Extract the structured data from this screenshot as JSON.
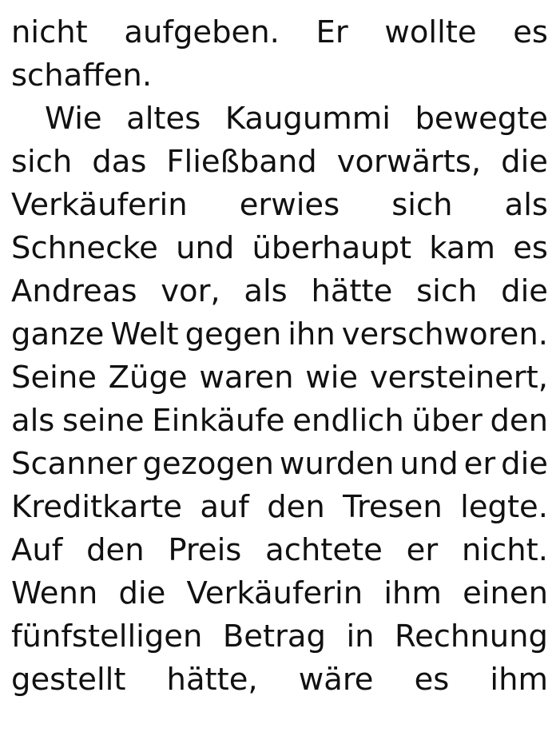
{
  "document": {
    "lines": [
      {
        "text": "nicht aufgeben. Er wollte es",
        "indent": false,
        "last": false
      },
      {
        "text": "schaffen.",
        "indent": false,
        "last": true
      },
      {
        "text": "Wie altes Kaugummi bewegte",
        "indent": true,
        "last": false
      },
      {
        "text": "sich das Fließband vorwärts, die",
        "indent": false,
        "last": false
      },
      {
        "text": "Verkäuferin erwies sich als",
        "indent": false,
        "last": false
      },
      {
        "text": "Schnecke und überhaupt kam es",
        "indent": false,
        "last": false
      },
      {
        "text": "Andreas vor, als hätte sich die",
        "indent": false,
        "last": false
      },
      {
        "text": "ganze Welt gegen ihn verschworen.",
        "indent": false,
        "last": false
      },
      {
        "text": "Seine Züge waren wie versteinert,",
        "indent": false,
        "last": false
      },
      {
        "text": "als seine Einkäufe endlich über den",
        "indent": false,
        "last": false
      },
      {
        "text": "Scanner gezogen wurden und er die",
        "indent": false,
        "last": false
      },
      {
        "text": "Kreditkarte auf den Tresen legte.",
        "indent": false,
        "last": false
      },
      {
        "text": "Auf den Preis achtete er nicht.",
        "indent": false,
        "last": false
      },
      {
        "text": "Wenn die Verkäuferin ihm einen",
        "indent": false,
        "last": false
      },
      {
        "text": "fünfstelligen Betrag in Rechnung",
        "indent": false,
        "last": false
      },
      {
        "text": "gestellt hätte, wäre es ihm",
        "indent": false,
        "last": false
      }
    ]
  }
}
